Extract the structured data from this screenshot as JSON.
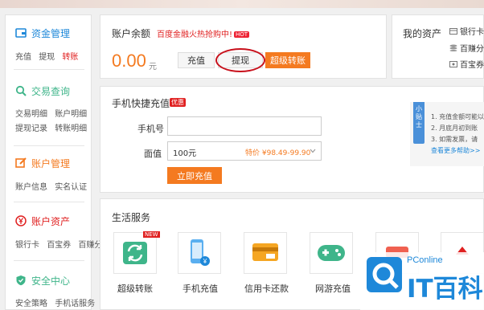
{
  "sidebar": {
    "funds": {
      "title": "资金管理",
      "links": [
        "充值",
        "提现",
        "转账"
      ]
    },
    "trades": {
      "title": "交易查询",
      "links1": [
        "交易明细",
        "账户明细"
      ],
      "links2": [
        "提现记录",
        "转账明细"
      ]
    },
    "account": {
      "title": "账户管理",
      "links": [
        "账户信息",
        "实名认证"
      ]
    },
    "assets": {
      "title": "账户资产",
      "links": [
        "银行卡",
        "百宝券",
        "百赚分"
      ]
    },
    "security": {
      "title": "安全中心",
      "links": [
        "安全策略",
        "手机话服务"
      ]
    }
  },
  "balance": {
    "label": "账户余额",
    "promo": "百度金融火热抢购中!",
    "hot_badge": "HOT",
    "amount": "0.00",
    "unit": "元",
    "recharge_label": "充值",
    "withdraw_label": "提现",
    "transfer_label": "超级转账"
  },
  "my_assets": {
    "title": "我的资产",
    "items": [
      "银行卡",
      "百赚分",
      "百宝券"
    ]
  },
  "mobile_recharge": {
    "title": "手机快捷充值",
    "badge": "优惠",
    "phone_label": "手机号",
    "phone_value": "",
    "value_label": "面值",
    "amount_value": "100元",
    "price_text": "特价 ¥98.49-99.90",
    "submit_label": "立即充值"
  },
  "tips": {
    "badge": "小贴士",
    "lines": [
      "1. 充值金额可能以",
      "2. 月底月初到账",
      "3. 如需发票，请"
    ],
    "more": "查看更多帮助>>"
  },
  "life_services": {
    "title": "生活服务",
    "items": [
      {
        "label": "超级转账",
        "badge": "NEW"
      },
      {
        "label": "手机充值"
      },
      {
        "label": "信用卡还款"
      },
      {
        "label": "网游充值"
      }
    ]
  },
  "watermark": {
    "brand": "PConline",
    "logo_text": "IT百科"
  },
  "colors": {
    "accent": "#f47a20",
    "red": "#e02020",
    "blue": "#1e88d9",
    "green": "#3fb58a"
  }
}
